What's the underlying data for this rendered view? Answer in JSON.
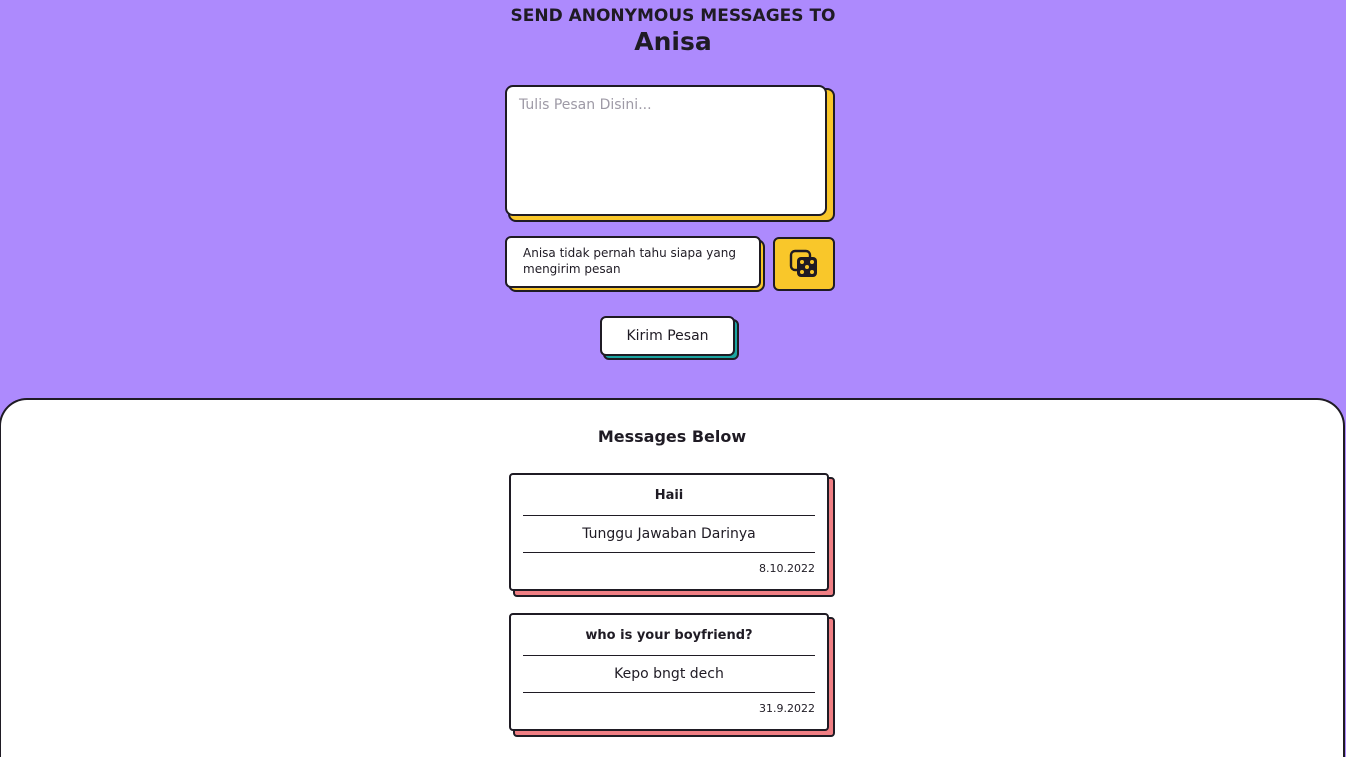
{
  "header": {
    "send_to_label": "SEND ANONYMOUS MESSAGES TO",
    "recipient_name": "Anisa"
  },
  "form": {
    "message_placeholder": "Tulis Pesan Disini...",
    "message_value": "",
    "anonymity_note": "Anisa tidak pernah tahu siapa yang mengirim pesan",
    "dice_icon": "dice-icon",
    "send_label": "Kirim Pesan"
  },
  "messages": {
    "heading": "Messages Below",
    "items": [
      {
        "question": "Haii",
        "answer": "Tunggu Jawaban Darinya",
        "date": "8.10.2022"
      },
      {
        "question": "who is your boyfriend?",
        "answer": "Kepo bngt dech",
        "date": "31.9.2022"
      }
    ]
  },
  "colors": {
    "background": "#ad8afd",
    "accent_yellow": "#f9c72a",
    "accent_teal": "#1aa5a1",
    "accent_red": "#f07f84",
    "ink": "#1f1b24"
  }
}
